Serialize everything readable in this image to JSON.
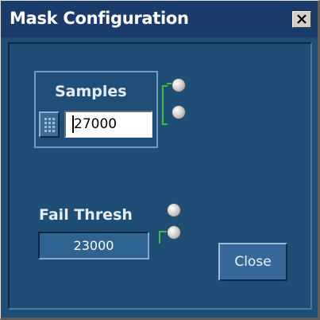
{
  "window": {
    "title": "Mask Configuration"
  },
  "samples": {
    "label": "Samples",
    "value": "27000"
  },
  "fail_thresh": {
    "label": "Fail Thresh",
    "value": "23000"
  },
  "buttons": {
    "close_label": "Close"
  },
  "icons": {
    "title_close": "close-x-icon",
    "keypad": "keypad-icon",
    "radio": "radio-button-icon"
  },
  "colors": {
    "background": "#1e4d75",
    "titlebar": "#1b3c6b",
    "accent_green": "#3fbf3f"
  }
}
